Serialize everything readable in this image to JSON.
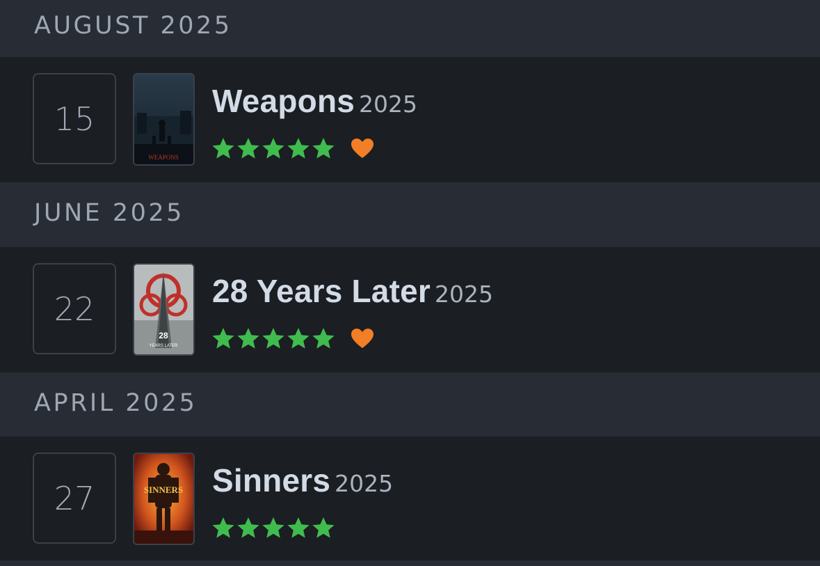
{
  "diary": {
    "sections": [
      {
        "month": "AUGUST 2025",
        "entry": {
          "day": "15",
          "title": "Weapons",
          "year": "2025",
          "stars": 5,
          "liked": true,
          "poster_text": "WEAPONS"
        }
      },
      {
        "month": "JUNE 2025",
        "entry": {
          "day": "22",
          "title": "28 Years Later",
          "year": "2025",
          "stars": 5,
          "liked": true,
          "poster_text": "28 YEARS LATER"
        }
      },
      {
        "month": "APRIL 2025",
        "entry": {
          "day": "27",
          "title": "Sinners",
          "year": "2025",
          "stars": 5,
          "liked": false,
          "poster_text": "SINNERS"
        }
      }
    ]
  },
  "colors": {
    "star": "#40bc4e",
    "heart": "#f27e27",
    "header_bg": "#272c35",
    "row_bg": "#1b1e22"
  },
  "icons": {
    "star": "star-icon",
    "heart": "heart-icon"
  }
}
